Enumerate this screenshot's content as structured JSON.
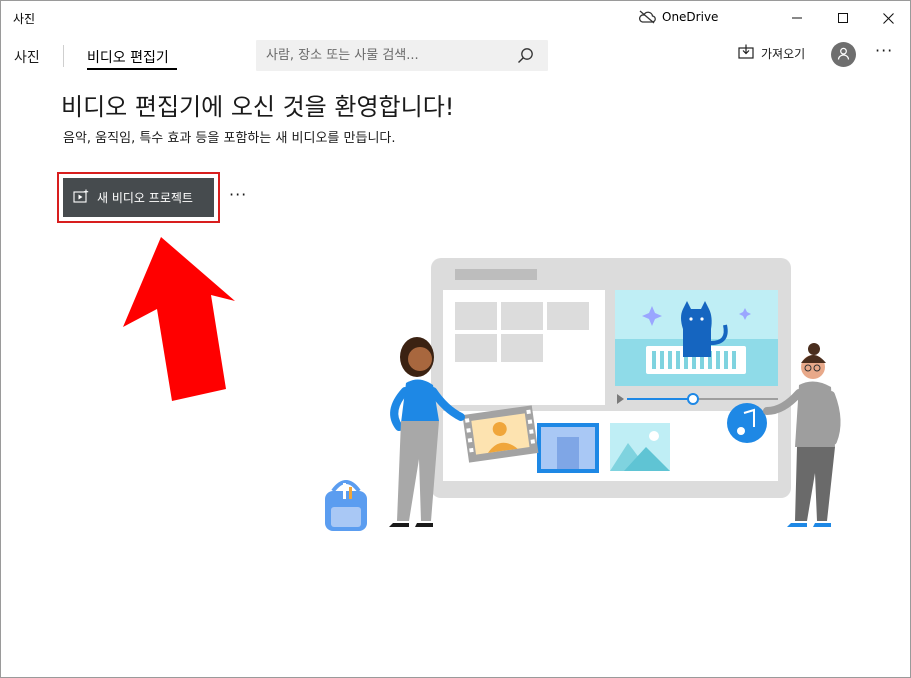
{
  "window": {
    "app_title": "사진",
    "onedrive_label": "OneDrive"
  },
  "nav": {
    "photos_label": "사진",
    "active_tab_label": "비디오 편집기",
    "search_placeholder": "사람, 장소 또는 사물 검색...",
    "import_label": "가져오기"
  },
  "content": {
    "welcome_title": "비디오 편집기에 오신 것을 환영합니다!",
    "subtitle": "음악, 움직임, 특수 효과 등을 포함하는 새 비디오를 만듭니다.",
    "new_project_label": "새 비디오 프로젝트",
    "more_label": "···"
  },
  "icons": {
    "onedrive": "cloud-off-icon",
    "minimize": "minimize-icon",
    "maximize": "maximize-icon",
    "close": "close-icon",
    "search": "search-icon",
    "import": "import-icon",
    "avatar": "person-icon",
    "new_project": "video-project-icon"
  },
  "colors": {
    "button_bg": "#464b4e",
    "highlight": "#d81e1e",
    "arrow": "#ff0000",
    "accent_blue": "#1e88e5"
  }
}
